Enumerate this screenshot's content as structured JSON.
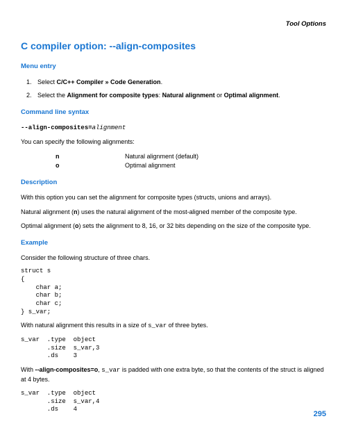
{
  "header": "Tool Options",
  "title": "C compiler option: --align-composites",
  "sections": {
    "menu_entry": {
      "heading": "Menu entry",
      "step1_pre": "Select ",
      "step1_bold": "C/C++ Compiler » Code Generation",
      "step1_post": ".",
      "step2_pre": "Select the ",
      "step2_bold1": "Alignment for composite types",
      "step2_mid": ": ",
      "step2_bold2": "Natural alignment",
      "step2_or": " or ",
      "step2_bold3": "Optimal alignment",
      "step2_post": "."
    },
    "cmdline": {
      "heading": "Command line syntax",
      "opt_bold": "--align-composites=",
      "opt_italic": "alignment",
      "intro": "You can specify the following alignments:",
      "rows": [
        {
          "key": "n",
          "val": "Natural alignment (default)"
        },
        {
          "key": "o",
          "val": "Optimal alignment"
        }
      ]
    },
    "description": {
      "heading": "Description",
      "p1": "With this option you can set the alignment for composite types (structs, unions and arrays).",
      "p2_pre": "Natural alignment (",
      "p2_b": "n",
      "p2_post": ") uses the natural alignment of the most-aligned member of the composite type.",
      "p3_pre": "Optimal alignment (",
      "p3_b": "o",
      "p3_post": ") sets the alignment to 8, 16, or 32 bits depending on the size of the composite type."
    },
    "example": {
      "heading": "Example",
      "intro": "Consider the following structure of three chars.",
      "code1": "struct s\n{\n    char a;\n    char b;\n    char c;\n} s_var;",
      "nat_pre": "With natural alignment this results in a size of ",
      "nat_mono": "s_var",
      "nat_post": " of three bytes.",
      "code2": "s_var  .type  object\n       .size  s_var,3\n       .ds    3",
      "opt_pre": "With ",
      "opt_bold": "--align-composites=o",
      "opt_mid": ", ",
      "opt_mono": "s_var",
      "opt_post": " is padded with one extra byte, so that the contents of the struct is aligned at 4 bytes.",
      "code3": "s_var  .type  object\n       .size  s_var,4\n       .ds    4"
    }
  },
  "page_number": "295"
}
